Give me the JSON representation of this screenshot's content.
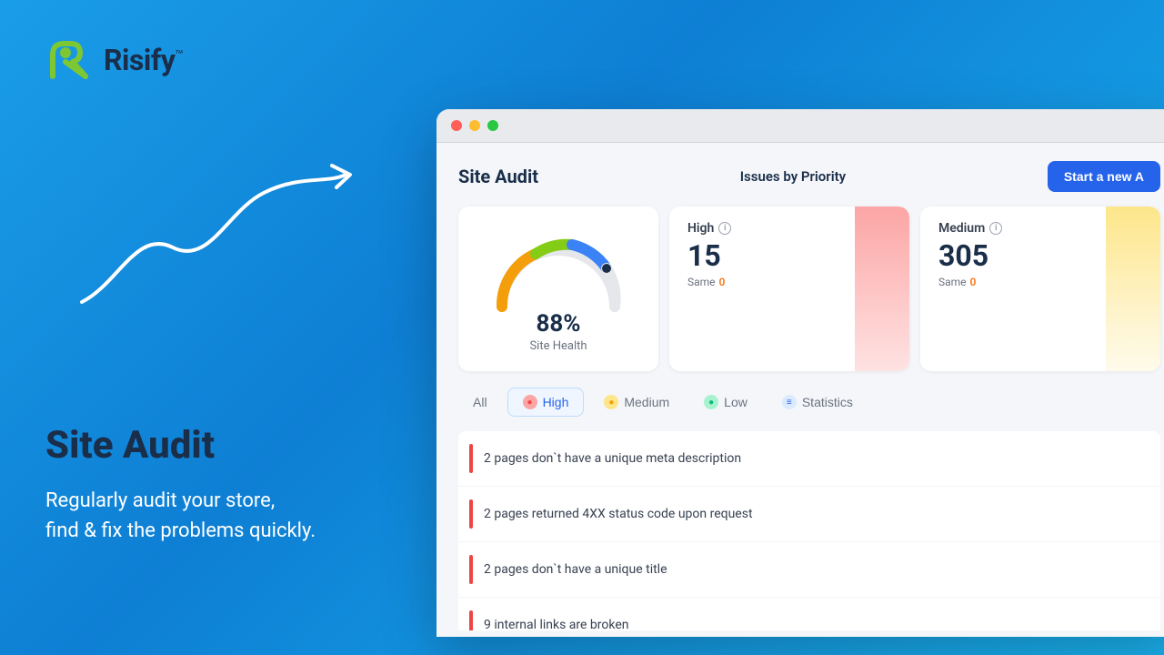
{
  "brand": {
    "name": "Risify",
    "tm": "™",
    "logo_color": "#7dc832"
  },
  "left": {
    "title": "Site Audit",
    "subtitle_line1": "Regularly audit your store,",
    "subtitle_line2": "find & fix the problems quickly."
  },
  "browser": {
    "window_dots": [
      "",
      "",
      ""
    ]
  },
  "header": {
    "audit_title": "Site Audit",
    "issues_label": "Issues by Priority",
    "start_btn": "Start a new A"
  },
  "gauge": {
    "percent": "88%",
    "label": "Site Health"
  },
  "priorities": [
    {
      "label": "High",
      "count": "15",
      "change_label": "Same",
      "change_value": "0",
      "bar_class": "priority-bar-high"
    },
    {
      "label": "Medium",
      "count": "305",
      "change_label": "Same",
      "change_value": "0",
      "bar_class": "priority-bar-medium"
    }
  ],
  "tabs": [
    {
      "label": "All",
      "type": "all",
      "active": false
    },
    {
      "label": "High",
      "type": "high",
      "active": true
    },
    {
      "label": "Medium",
      "type": "medium",
      "active": false
    },
    {
      "label": "Low",
      "type": "low",
      "active": false
    },
    {
      "label": "Statistics",
      "type": "stats",
      "active": false
    }
  ],
  "issues": [
    {
      "text": "2 pages don`t have a unique meta description"
    },
    {
      "text": "2 pages returned 4XX status code upon request"
    },
    {
      "text": "2 pages don`t have a unique title"
    },
    {
      "text": "9 internal links are broken"
    }
  ]
}
